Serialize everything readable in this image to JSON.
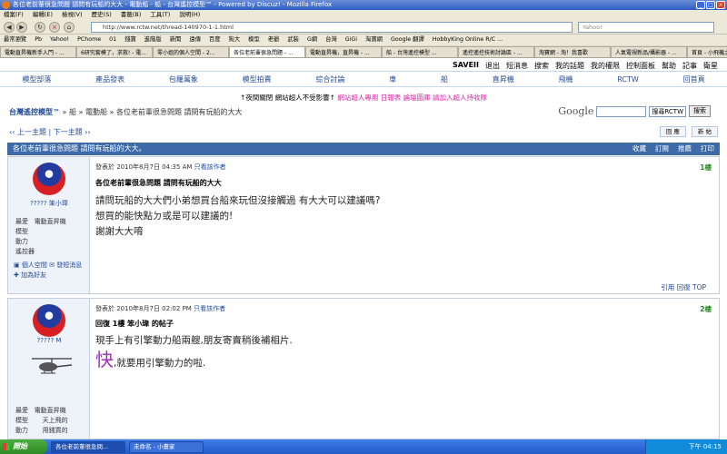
{
  "browser": {
    "title": "各位老前輩很急問題 請問有玩船的大大 - 電動船 - 船 - 台灣遙控模型™ - Powered by Discuz! - Mozilla Firefox",
    "menu": [
      "檔案(F)",
      "編輯(E)",
      "檢視(V)",
      "歷史(S)",
      "書籤(B)",
      "工具(T)",
      "說明(H)"
    ],
    "url": "http://www.rctw.net/thread-140970-1-1.html",
    "search_placeholder": "Yahoo!",
    "bookmarks": [
      "最常瀏覽",
      "Pb",
      "Yahoo!",
      "PChome",
      "01",
      "錢寶",
      "進階版",
      "新聞",
      "遠傳",
      "百度",
      "狗大",
      "模型",
      "老爺",
      "武裝",
      "G網",
      "台灣",
      "GiGi",
      "淘寶網",
      "Google 翻譯",
      "HobbyKing Online R/C ..."
    ],
    "tabs": [
      "電動直昇機新手入門 - ...",
      "6研究套模了，求救! - 電...",
      "零小姐的個人空間 - 2...",
      "各位老前輩很急問題 - ...",
      "電動直昇機，直昇機 - ...",
      "船 - 台灣遙控模型 ...",
      "遙控遙控技術討論區 - ...",
      "淘寶網 - 淘！我喜歡",
      "人氣電視新品/攝影器 - ...",
      "首頁 - 小飛機之家-淘寶網"
    ]
  },
  "site": {
    "toplinks": [
      "SAVEII",
      "退出",
      "短消息",
      "搜索",
      "我的話題",
      "我的權限",
      "控制面板",
      "幫助",
      "記事",
      "衛星"
    ],
    "nav": [
      "模型部落",
      "產品發表",
      "包羅萬象",
      "模型拍賣",
      "綜合討論",
      "車",
      "船",
      "直昇機",
      "飛機",
      "RCTW",
      "回首頁"
    ],
    "notice_prefix": "↑夜間關閉 網站超人不受影響↑",
    "notice_links": "網站超人專用 日報表 論壇圖庫 請加入超人持收隊",
    "breadcrumb_home": "台灣遙控模型™",
    "breadcrumb_rest": " » 船 » 電動船 » 各位老前輩很急問題 請問有玩船的大大",
    "google_logo": "Google",
    "google_select": "搜尋RCTW",
    "google_button": "搜索",
    "topic_nav": "‹‹ 上一主題 | 下一主題 ››",
    "reply_button": "回 應",
    "new_button": "新 帖",
    "thread_title": "各位老前輩很急問題 請問有玩船的大大。",
    "thread_links": [
      "收藏",
      "訂閱",
      "推薦",
      "打印"
    ]
  },
  "posts": [
    {
      "username": "????? 笨小瑋",
      "stats": [
        [
          "最愛",
          "電動直昇機"
        ],
        [
          "模型",
          ""
        ],
        [
          "動力",
          ""
        ],
        [
          "遙控器",
          ""
        ]
      ],
      "links": [
        "個人空間",
        "發短消息",
        "加為好友"
      ],
      "meta_prefix": "發表於 2010年8月7日 04:35 AM",
      "meta_link": "只看該作者",
      "floor": "1樓",
      "title": "各位老前輩很急問題 請問有玩船的大大",
      "body": [
        "請問玩船的大大們小弟想買台船來玩但沒接觸過 有大大可以建議嗎?",
        "想買的能快點ㄉ或是可以建議的!",
        "謝謝大大唷"
      ],
      "footer": "引用 回復 TOP"
    },
    {
      "username": "????? M",
      "stats": [
        [
          "最愛",
          "電動直昇機"
        ],
        [
          "模型",
          "天上飛的"
        ],
        [
          "動力",
          "用錢買的"
        ]
      ],
      "meta_prefix": "發表於 2010年8月7日 02:02 PM",
      "meta_link": "只看該作者",
      "floor": "2樓",
      "title": "回復 1樓 笨小瑋 的帖子",
      "body_line1": "現手上有引擎動力船兩艘,朋友寄賣稍後補相片.",
      "body_big": "快",
      "body_line2": ",就要用引擎動力的啦."
    }
  ],
  "taskbar": {
    "start": "開始",
    "items": [
      "各位老前輩很急問...",
      "未命名 - 小畫家"
    ],
    "time": "下午 04:15"
  }
}
